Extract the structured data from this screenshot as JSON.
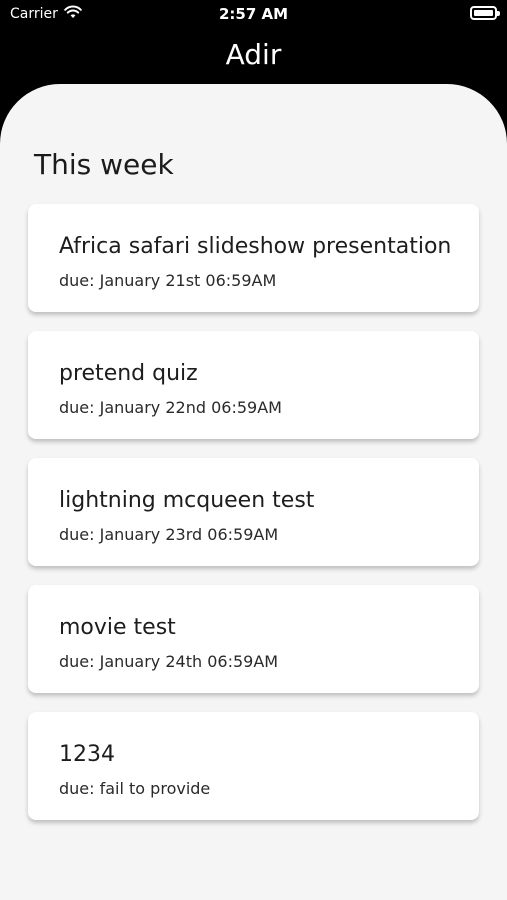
{
  "status_bar": {
    "carrier": "Carrier",
    "time": "2:57 AM"
  },
  "header": {
    "title": "Adir"
  },
  "main": {
    "section_title": "This week",
    "tasks": [
      {
        "title": "Africa safari slideshow presentation",
        "due": "due: January 21st 06:59AM"
      },
      {
        "title": "pretend quiz",
        "due": "due: January 22nd 06:59AM"
      },
      {
        "title": "lightning mcqueen test",
        "due": "due: January 23rd 06:59AM"
      },
      {
        "title": "movie test",
        "due": "due: January 24th 06:59AM"
      },
      {
        "title": "1234",
        "due": "due: fail to provide"
      }
    ]
  },
  "colors": {
    "header_bg": "#000000",
    "sheet_bg": "#f5f5f5",
    "card_bg": "#ffffff"
  }
}
